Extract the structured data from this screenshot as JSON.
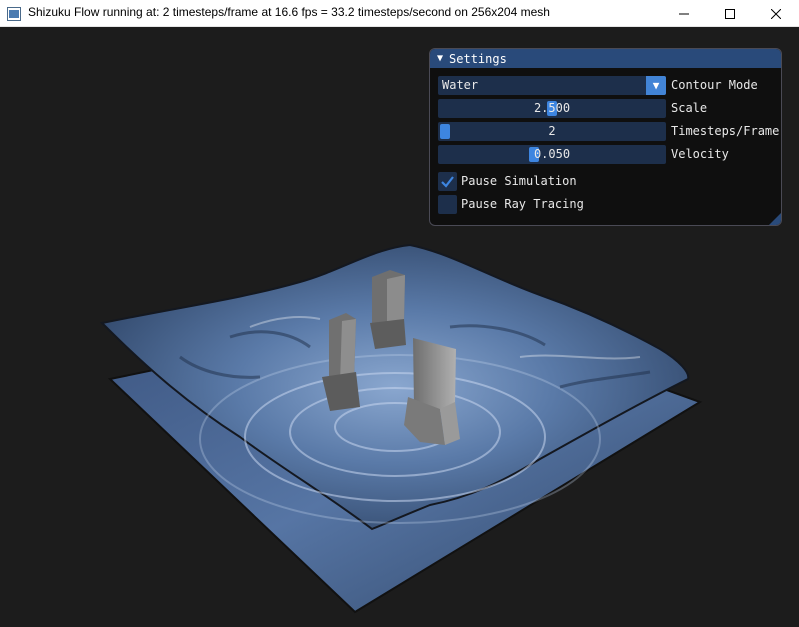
{
  "window": {
    "title": "Shizuku Flow running at: 2 timesteps/frame at 16.6 fps = 33.2 timesteps/second on 256x204 mesh",
    "app_icon": "window-app-icon",
    "controls": [
      "minimize-icon",
      "maximize-icon",
      "close-icon"
    ]
  },
  "settings": {
    "header": "Settings",
    "collapse_icon": "triangle-down-icon",
    "contour_mode": {
      "value": "Water",
      "label": "Contour Mode",
      "arrow_icon": "triangle-down-icon"
    },
    "scale": {
      "value": "2.500",
      "label": "Scale",
      "level": 0.5
    },
    "timesteps_per_frame": {
      "value": "2",
      "label": "Timesteps/Frame",
      "level": 0.0
    },
    "velocity": {
      "value": "0.050",
      "label": "Velocity",
      "level": 0.42
    },
    "pause_simulation": {
      "label": "Pause Simulation",
      "checked": true
    },
    "pause_ray_tracing": {
      "label": "Pause Ray Tracing",
      "checked": false
    }
  },
  "colors": {
    "background": "#1c1c1c",
    "header": "#294a7a",
    "frame": "#1d2f4b",
    "accent": "#4284d6",
    "water": "#5a7aa8"
  }
}
